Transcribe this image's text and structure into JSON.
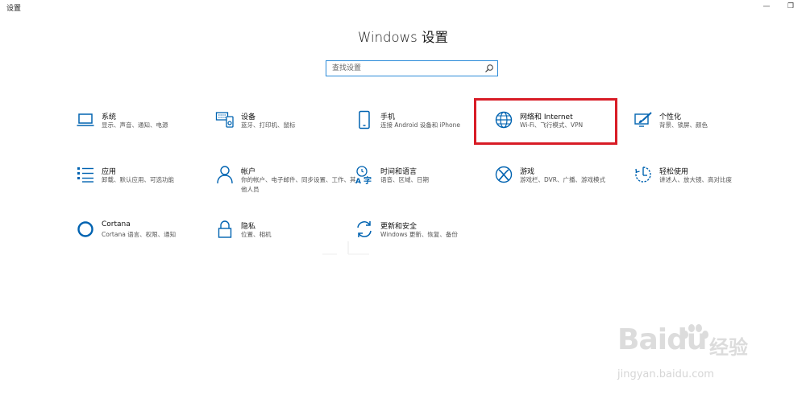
{
  "window": {
    "title": "设置",
    "minimize_glyph": "—",
    "restore_glyph": "❐"
  },
  "header": {
    "title": "Windows 设置"
  },
  "search": {
    "placeholder": "查找设置",
    "icon": "search-icon"
  },
  "tiles": [
    {
      "name": "系统",
      "desc": "显示、声音、通知、电源",
      "icon": "laptop-icon"
    },
    {
      "name": "设备",
      "desc": "蓝牙、打印机、鼠标",
      "icon": "devices-icon"
    },
    {
      "name": "手机",
      "desc": "连接 Android 设备和 iPhone",
      "icon": "phone-icon"
    },
    {
      "name": "网络和 Internet",
      "desc": "Wi-Fi、飞行模式、VPN",
      "icon": "globe-icon"
    },
    {
      "name": "个性化",
      "desc": "背景、锁屏、颜色",
      "icon": "paintbrush-icon"
    },
    {
      "name": "应用",
      "desc": "卸载、默认应用、可选功能",
      "icon": "apps-list-icon"
    },
    {
      "name": "帐户",
      "desc": "你的帐户、电子邮件、同步设置、工作、其他人员",
      "icon": "person-icon"
    },
    {
      "name": "时间和语言",
      "desc": "语音、区域、日期",
      "icon": "time-language-icon"
    },
    {
      "name": "游戏",
      "desc": "游戏栏、DVR、广播、游戏模式",
      "icon": "xbox-icon"
    },
    {
      "name": "轻松使用",
      "desc": "讲述人、放大镜、高对比度",
      "icon": "ease-of-access-icon"
    },
    {
      "name": "Cortana",
      "desc": "Cortana 语言、权限、通知",
      "icon": "cortana-icon"
    },
    {
      "name": "隐私",
      "desc": "位置、相机",
      "icon": "lock-icon"
    },
    {
      "name": "更新和安全",
      "desc": "Windows 更新、恢复、备份",
      "icon": "sync-icon"
    }
  ],
  "colors": {
    "accent": "#0063b1",
    "highlight_border": "#d81c26",
    "search_border": "#2b8ad8"
  },
  "watermark": {
    "logo_text": "Baidu",
    "cn_text": "经验",
    "url": "jingyan.baidu.com"
  }
}
